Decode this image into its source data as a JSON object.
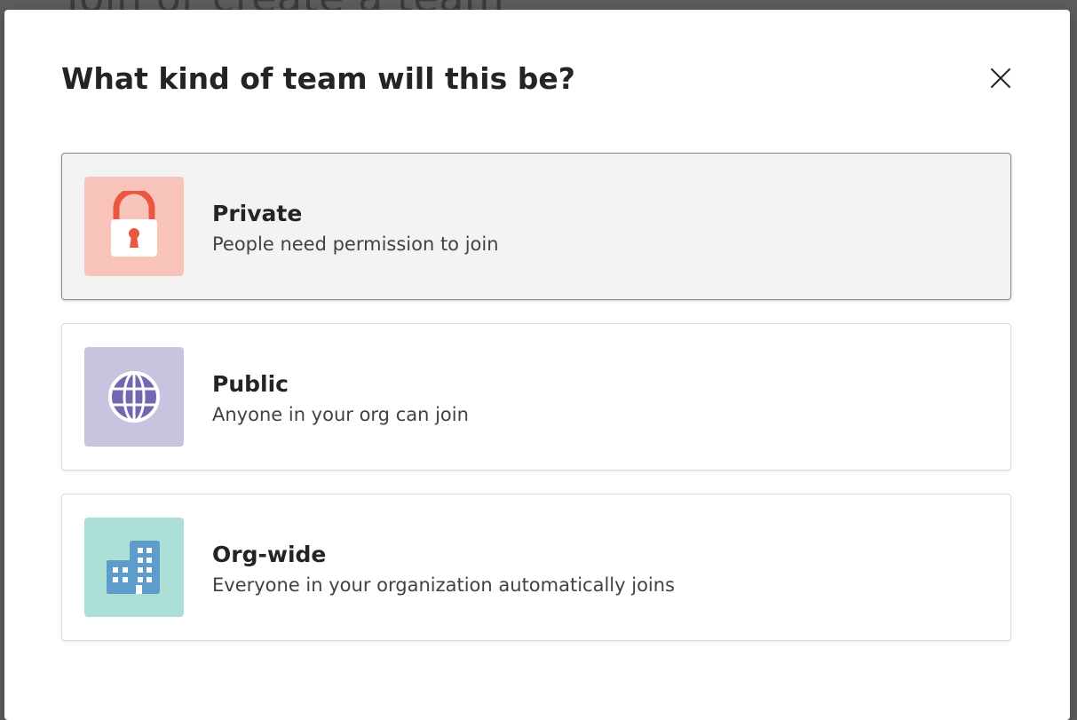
{
  "backdrop": {
    "title": "Join or create a team"
  },
  "dialog": {
    "title": "What kind of team will this be?",
    "close_icon": "close-icon"
  },
  "options": [
    {
      "title": "Private",
      "description": "People need permission to join",
      "icon": "lock-icon",
      "icon_bg": "#f8c3b9",
      "icon_color": "#e8573f",
      "selected": true
    },
    {
      "title": "Public",
      "description": "Anyone in your org can join",
      "icon": "globe-icon",
      "icon_bg": "#c9c3e0",
      "icon_color": "#7566b0",
      "selected": false
    },
    {
      "title": "Org-wide",
      "description": "Everyone in your organization automatically joins",
      "icon": "building-icon",
      "icon_bg": "#acdfd6",
      "icon_color": "#5d9ccb",
      "selected": false
    }
  ]
}
